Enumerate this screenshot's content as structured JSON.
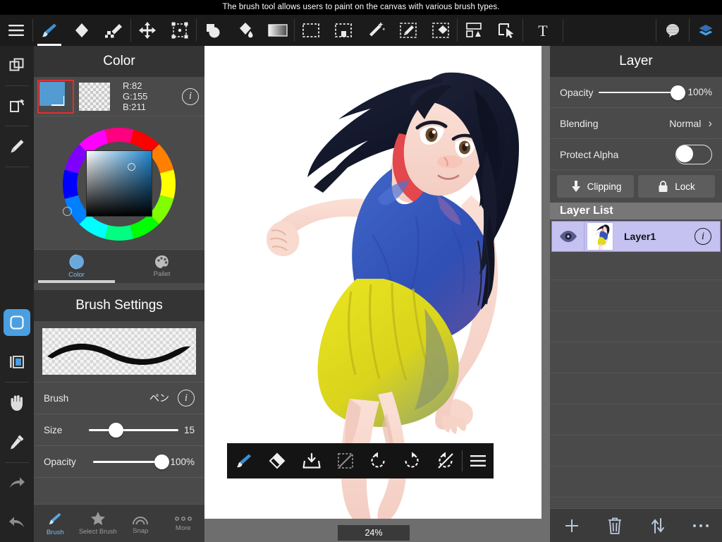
{
  "hint": {
    "text": "The brush tool allows users to paint on the canvas with various brush types."
  },
  "top_toolbar": {
    "items": [
      {
        "name": "menu-icon",
        "label": "Menu"
      },
      {
        "name": "brush-tool-icon",
        "label": "Brush"
      },
      {
        "name": "eraser-tool-icon",
        "label": "Eraser"
      },
      {
        "name": "smudge-tool-icon",
        "label": "Smudge"
      },
      {
        "name": "move-tool-icon",
        "label": "Move"
      },
      {
        "name": "transform-tool-icon",
        "label": "Transform"
      },
      {
        "name": "shape-tool-icon",
        "label": "Shape"
      },
      {
        "name": "bucket-fill-icon",
        "label": "Bucket"
      },
      {
        "name": "gradient-tool-icon",
        "label": "Gradient"
      },
      {
        "name": "rect-select-icon",
        "label": "Select"
      },
      {
        "name": "select-fill-icon",
        "label": "Select Fill"
      },
      {
        "name": "magic-wand-icon",
        "label": "Magic Wand"
      },
      {
        "name": "select-pen-icon",
        "label": "Select Pen"
      },
      {
        "name": "select-eraser-icon",
        "label": "Select Eraser"
      },
      {
        "name": "canvas-layout-icon",
        "label": "Canvas"
      },
      {
        "name": "crop-icon",
        "label": "Crop"
      },
      {
        "name": "text-tool-icon",
        "label": "Text"
      },
      {
        "name": "balloon-tool-icon",
        "label": "Balloon"
      },
      {
        "name": "layer-panel-icon",
        "label": "Layer"
      }
    ]
  },
  "left_rail": {
    "items": [
      {
        "name": "copy-icon",
        "label": "Copy"
      },
      {
        "name": "flip-icon",
        "label": "Flip"
      },
      {
        "name": "pen-icon",
        "label": "Pen"
      },
      {
        "name": "rounded-square-icon",
        "label": "Selection Shape"
      },
      {
        "name": "panel-toggle-icon",
        "label": "Panel"
      },
      {
        "name": "hand-icon",
        "label": "Hand"
      },
      {
        "name": "eyedropper-icon",
        "label": "Eyedropper"
      },
      {
        "name": "redo-icon",
        "label": "Redo"
      },
      {
        "name": "undo-icon",
        "label": "Undo"
      }
    ]
  },
  "color_panel": {
    "title": "Color",
    "rgb": {
      "r_label": "R:82",
      "g_label": "G:155",
      "b_label": "B:211"
    },
    "foreground_color": "#529bd3",
    "info_glyph": "i",
    "tabs": [
      {
        "name": "tab-color",
        "label": "Color",
        "active": true
      },
      {
        "name": "tab-pallet",
        "label": "Pallet",
        "active": false
      }
    ]
  },
  "brush_panel": {
    "title": "Brush Settings",
    "brush_row": {
      "label": "Brush",
      "value": "ペン",
      "info_glyph": "i"
    },
    "size_row": {
      "label": "Size",
      "value": "15",
      "percent": 24
    },
    "opacity_row": {
      "label": "Opacity",
      "value": "100%",
      "percent": 92
    },
    "tabs": [
      {
        "name": "tab-brush",
        "label": "Brush",
        "active": true
      },
      {
        "name": "tab-select-brush",
        "label": "Select Brush",
        "active": false
      },
      {
        "name": "tab-snap",
        "label": "Snap",
        "active": false
      },
      {
        "name": "tab-more",
        "label": "More",
        "active": false
      }
    ]
  },
  "canvas": {
    "zoom_label": "24%",
    "float_toolbar": [
      {
        "name": "brush-icon",
        "label": "Brush"
      },
      {
        "name": "eraser-icon",
        "label": "Eraser"
      },
      {
        "name": "import-icon",
        "label": "Import"
      },
      {
        "name": "deselect-icon",
        "label": "Deselect"
      },
      {
        "name": "undo-icon",
        "label": "Undo"
      },
      {
        "name": "redo-icon",
        "label": "Redo"
      },
      {
        "name": "clear-icon",
        "label": "Clear"
      },
      {
        "name": "hamburger-icon",
        "label": "More"
      }
    ]
  },
  "layer_panel": {
    "title": "Layer",
    "opacity": {
      "label": "Opacity",
      "value": "100%",
      "percent": 92
    },
    "blending": {
      "label": "Blending",
      "value": "Normal",
      "chevron": "›"
    },
    "protect_alpha": {
      "label": "Protect Alpha",
      "on": false
    },
    "clipping_button": "Clipping",
    "lock_button": "Lock",
    "layer_list_title": "Layer List",
    "layers": [
      {
        "name": "Layer1",
        "visible": true,
        "selected": true,
        "info_glyph": "i"
      }
    ],
    "empty_slot_count": 8,
    "bottom_actions": [
      {
        "name": "add-layer-icon",
        "label": "Add"
      },
      {
        "name": "delete-layer-icon",
        "label": "Delete"
      },
      {
        "name": "reorder-layer-icon",
        "label": "Reorder"
      },
      {
        "name": "more-options-icon",
        "label": "More"
      }
    ]
  },
  "colors": {
    "accent_blue": "#4a9fe0",
    "panel_bg": "#4a4a4a",
    "panel_header": "#343434",
    "toolbar_bg": "#1b1b1b",
    "canvas_bg": "#6e6e6e",
    "layer_selected": "#c5c2f2",
    "selection_red": "#e03030"
  }
}
